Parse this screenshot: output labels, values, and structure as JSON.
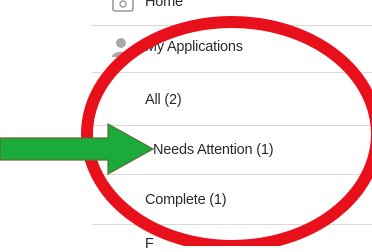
{
  "sidebar": {
    "items": [
      {
        "label": "Home",
        "icon": "home-icon"
      },
      {
        "label": "My Applications",
        "icon": "user-icon"
      },
      {
        "label": "All (2)"
      },
      {
        "label": "Needs Attention (1)"
      },
      {
        "label": "Complete (1)"
      },
      {
        "label": "F"
      }
    ]
  },
  "annotation": {
    "arrow_color": "#1aab3a",
    "circle_color": "#e8101a"
  }
}
